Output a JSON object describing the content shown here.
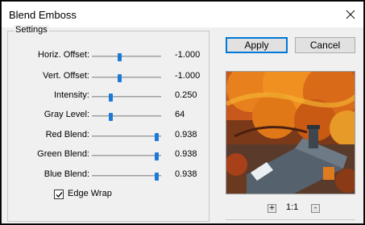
{
  "window": {
    "title": "Blend Emboss"
  },
  "settings": {
    "legend": "Settings",
    "rows": [
      {
        "label": "Horiz. Offset:",
        "value": "-1.000",
        "slider_fraction": 0.4
      },
      {
        "label": "Vert. Offset:",
        "value": "-1.000",
        "slider_fraction": 0.4
      },
      {
        "label": "Intensity:",
        "value": "0.250",
        "slider_fraction": 0.27
      },
      {
        "label": "Gray Level:",
        "value": "64",
        "slider_fraction": 0.27
      },
      {
        "label": "Red Blend:",
        "value": "0.938",
        "slider_fraction": 0.93
      },
      {
        "label": "Green Blend:",
        "value": "0.938",
        "slider_fraction": 0.93
      },
      {
        "label": "Blue Blend:",
        "value": "0.938",
        "slider_fraction": 0.93
      }
    ],
    "edge_wrap": {
      "label": "Edge Wrap",
      "checked": true
    }
  },
  "buttons": {
    "apply": "Apply",
    "cancel": "Cancel"
  },
  "zoom": {
    "minus": "-",
    "plus": "+",
    "level": "1:1"
  },
  "colors": {
    "accent": "#0078d7",
    "slider_thumb": "#1c7ad6"
  }
}
